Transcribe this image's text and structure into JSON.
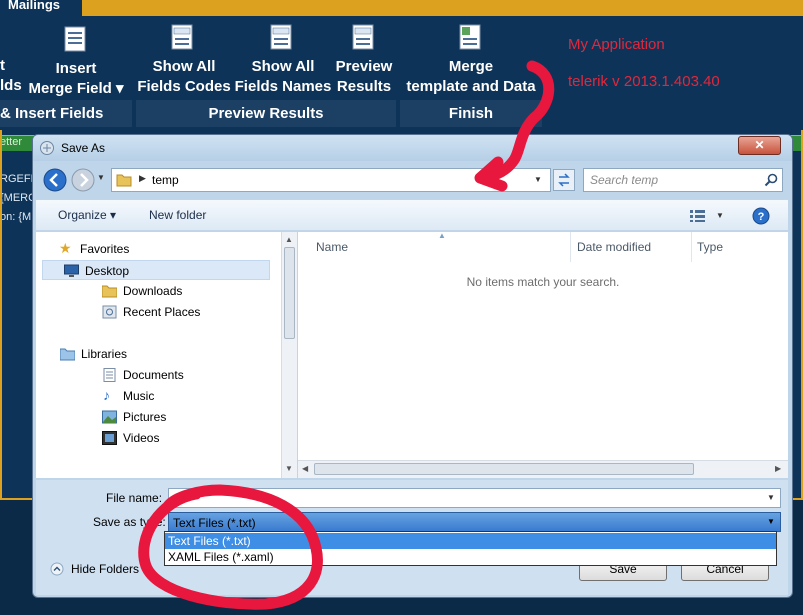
{
  "app": {
    "tab": "Mailings",
    "ribbon_buttons": [
      {
        "line1": "t",
        "line2": "lds"
      },
      {
        "line1": "Insert",
        "line2": "Merge Field ▾"
      },
      {
        "line1": "Show All",
        "line2": "Fields Codes"
      },
      {
        "line1": "Show All",
        "line2": "Fields Names"
      },
      {
        "line1": "Preview",
        "line2": "Results"
      },
      {
        "line1": "Merge",
        "line2": "template and Data"
      }
    ],
    "groups": [
      "& Insert Fields",
      "Preview Results",
      "Finish"
    ],
    "info_title": "My Application",
    "info_version": "telerik v  2013.1.403.40",
    "green_text": "etter",
    "doc_lines": [
      "RGEFI",
      "{MERC",
      "on: {M"
    ]
  },
  "dialog": {
    "title": "Save As",
    "close": "✕",
    "address": "temp",
    "search_placeholder": "Search temp",
    "toolbar": {
      "organize": "Organize ▾",
      "new_folder": "New folder"
    },
    "nav": {
      "favorites": "Favorites",
      "desktop": "Desktop",
      "downloads": "Downloads",
      "recent": "Recent Places",
      "libraries": "Libraries",
      "documents": "Documents",
      "music": "Music",
      "pictures": "Pictures",
      "videos": "Videos"
    },
    "columns": {
      "name": "Name",
      "date": "Date modified",
      "type": "Type"
    },
    "empty_message": "No items match your search.",
    "file_name_label": "File name:",
    "file_name_value": "",
    "save_type_label": "Save as type:",
    "save_type_value": "Text Files (*.txt)",
    "options": [
      "Text Files (*.txt)",
      "XAML Files (*.xaml)"
    ],
    "hide_folders": "Hide Folders",
    "save": "Save",
    "cancel": "Cancel"
  },
  "colors": {
    "accent": "#dca11e",
    "app_bg": "#0e3358",
    "annotation": "#e8173e",
    "selection": "#3d8ee4"
  }
}
